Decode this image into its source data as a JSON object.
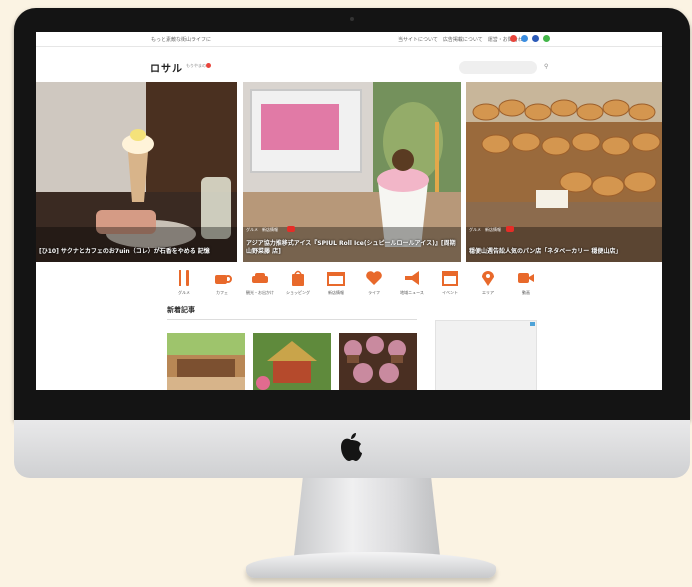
{
  "site": {
    "tagline": "もっと素敵な街山ライフに",
    "top_links": "当サイトについて　広告掲載について　運営・お問合わせ",
    "logo": "ロサル",
    "logo_sub": "もりやまの",
    "search_icon": "search-icon"
  },
  "hero_cards": [
    {
      "caption": "[ひ10] サクナとカフェのお7uin（コレ）が石香をやめる 記憶",
      "tags": ""
    },
    {
      "caption": "アジア協力推移式アイス『SPIUL Roll Ice(シュピールロールアイス)』[周期山野菜藤 店]",
      "tags": "グルメ　新店情報"
    },
    {
      "caption": "穏便山週告訟人気のパン店「ネタベーカリー 穏便山店」",
      "tags": "グルメ　新店情報"
    }
  ],
  "categories": [
    {
      "label": "グルメ",
      "icon": "fork-knife-icon"
    },
    {
      "label": "カフェ",
      "icon": "coffee-cup-icon"
    },
    {
      "label": "観光・お出かけ",
      "icon": "car-icon"
    },
    {
      "label": "ショッピング",
      "icon": "shopping-bag-icon"
    },
    {
      "label": "新店情報",
      "icon": "shop-icon"
    },
    {
      "label": "ライフ",
      "icon": "heart-icon"
    },
    {
      "label": "地域ニュース",
      "icon": "megaphone-icon"
    },
    {
      "label": "イベント",
      "icon": "calendar-icon"
    },
    {
      "label": "エリア",
      "icon": "map-pin-icon"
    },
    {
      "label": "動画",
      "icon": "video-camera-icon"
    }
  ],
  "section": {
    "title": "新着記事"
  },
  "colors": {
    "accent": "#e8692b",
    "bezel": "#141414",
    "background": "#fbf3e3"
  }
}
